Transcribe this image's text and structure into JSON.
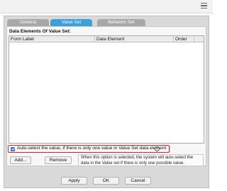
{
  "tabs": [
    {
      "label": "General"
    },
    {
      "label": "Value Set"
    },
    {
      "label": "Behavior Set"
    }
  ],
  "section": {
    "title": "Data Elements Of Value Set:"
  },
  "grid": {
    "columns": [
      "Form Label",
      "Data Element",
      "Order"
    ]
  },
  "autoselect": {
    "label": "Auto-select the value, if there is only one value in Value Set data element",
    "help": "?",
    "checked": true
  },
  "actions": {
    "add": "Add...",
    "remove": "Remove"
  },
  "tooltip": {
    "text": "When this option is selected, the system will auto-select the data in the Value set if there is only one possible value."
  },
  "footer": {
    "apply": "Apply",
    "ok": "OK",
    "cancel": "Cancel"
  },
  "colors": {
    "accent": "#3f9fd9",
    "highlight": "#e0202a",
    "inactive_tab": "#a8a8a8"
  }
}
